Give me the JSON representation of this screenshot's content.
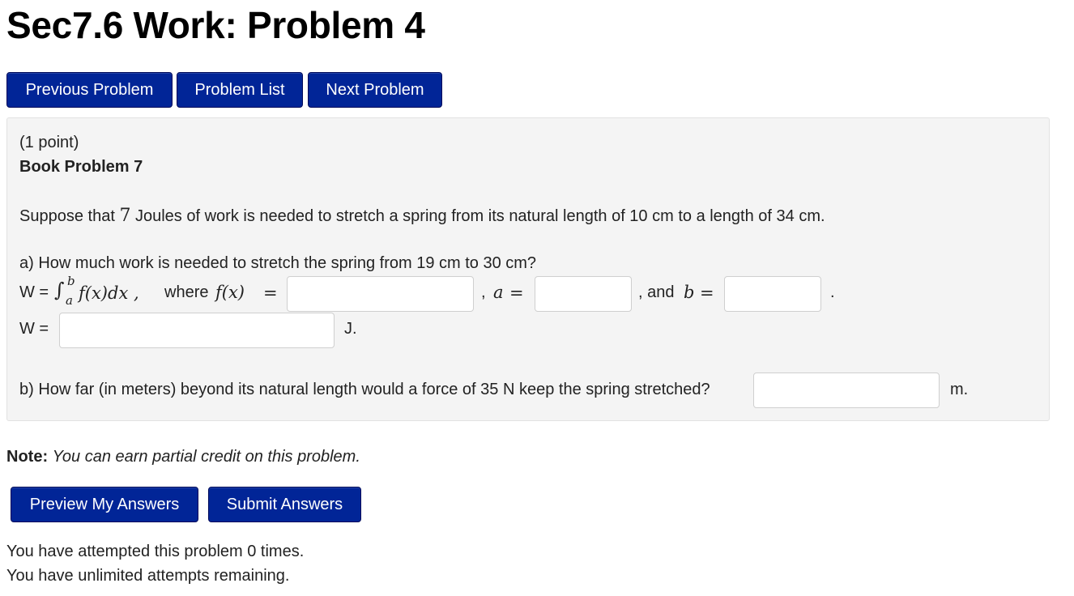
{
  "page": {
    "title": "Sec7.6 Work: Problem 4"
  },
  "nav": {
    "previous": "Previous Problem",
    "list": "Problem List",
    "next": "Next Problem"
  },
  "problem": {
    "points": "(1 point)",
    "book": "Book Problem 7",
    "statement_pre": "Suppose that ",
    "statement_num": "7",
    "statement_post": " Joules of work is needed to stretch a spring from its natural length of 10 cm to a length of 34 cm.",
    "part_a": "a) How much work is needed to stretch the spring from 19 cm to 30 cm?",
    "w_eq": "W = ",
    "int_upper": "b",
    "int_lower": "a",
    "integrand": "f(x)dx ,",
    "where": "where ",
    "fx": "f(x)",
    "eq": "=",
    "comma_a": ", ",
    "a_var": "a",
    "and_b": ", and ",
    "b_var": "b",
    "period": ".",
    "w_label": "W =",
    "j_unit": "J.",
    "part_b": "b) How far (in meters) beyond its natural length would a force of 35 N keep the spring stretched?",
    "m_unit": "m.",
    "answers": {
      "fx": "",
      "a": "",
      "b": "",
      "w": "",
      "dist": ""
    }
  },
  "note": {
    "label": "Note:",
    "text": "You can earn partial credit on this problem."
  },
  "actions": {
    "preview": "Preview My Answers",
    "submit": "Submit Answers"
  },
  "status": {
    "attempts": "You have attempted this problem 0 times.",
    "remaining": "You have unlimited attempts remaining."
  }
}
